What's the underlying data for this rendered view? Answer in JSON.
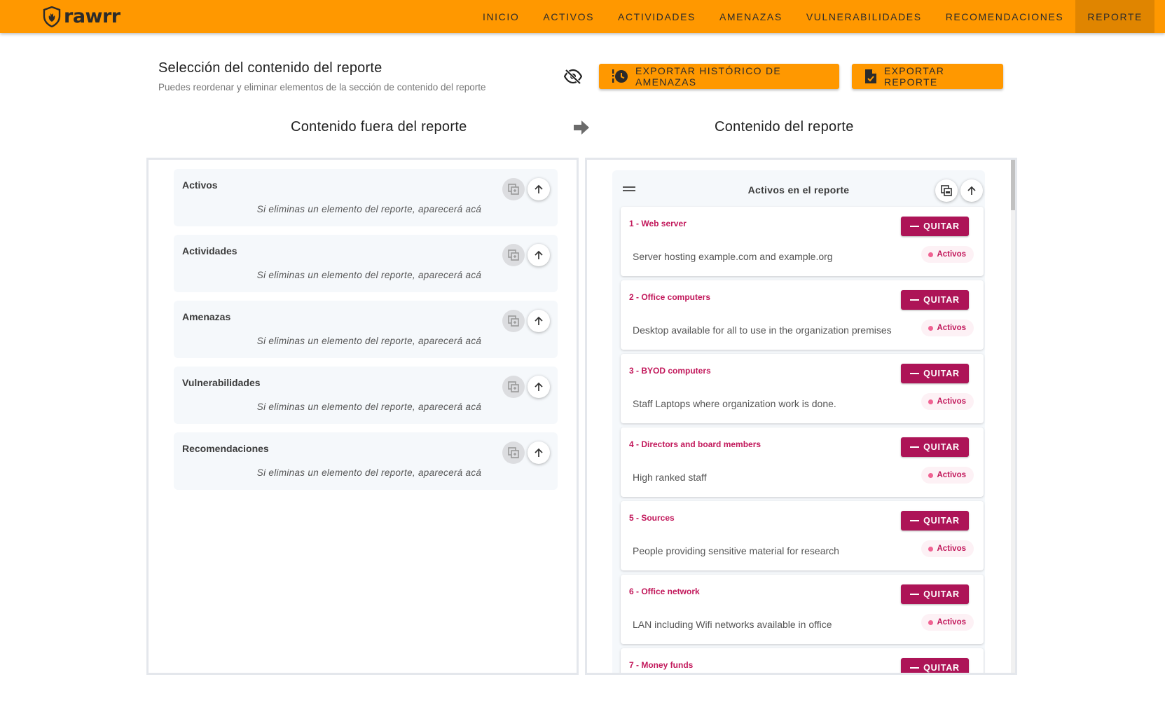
{
  "navbar": {
    "logo_text": "rawrr",
    "items": [
      "INICIO",
      "ACTIVOS",
      "ACTIVIDADES",
      "AMENAZAS",
      "VULNERABILIDADES",
      "RECOMENDACIONES",
      "REPORTE"
    ],
    "active": "REPORTE"
  },
  "header": {
    "title": "Selección del contenido del reporte",
    "subtitle": "Puedes reordenar y eliminar elementos de la sección de contenido del reporte",
    "export_history_label": "EXPORTAR HISTÓRICO DE AMENAZAS",
    "export_report_label": "EXPORTAR REPORTE"
  },
  "left_column": {
    "title": "Contenido fuera del reporte",
    "sections": [
      {
        "title": "Activos",
        "empty_text": "Si eliminas un elemento del reporte, aparecerá acá"
      },
      {
        "title": "Actividades",
        "empty_text": "Si eliminas un elemento del reporte, aparecerá acá"
      },
      {
        "title": "Amenazas",
        "empty_text": "Si eliminas un elemento del reporte, aparecerá acá"
      },
      {
        "title": "Vulnerabilidades",
        "empty_text": "Si eliminas un elemento del reporte, aparecerá acá"
      },
      {
        "title": "Recomendaciones",
        "empty_text": "Si eliminas un elemento del reporte, aparecerá acá"
      }
    ]
  },
  "right_column": {
    "title": "Contenido del reporte",
    "section_title": "Activos en el reporte",
    "remove_label": "QUITAR",
    "items": [
      {
        "title": "1 - Web server",
        "description": "Server hosting example.com and example.org",
        "badge": "Activos"
      },
      {
        "title": "2 - Office computers",
        "description": "Desktop available for all to use in the organization premises",
        "badge": "Activos"
      },
      {
        "title": "3 - BYOD computers",
        "description": "Staff Laptops where organization work is done.",
        "badge": "Activos"
      },
      {
        "title": "4 - Directors and board members",
        "description": "High ranked staff",
        "badge": "Activos"
      },
      {
        "title": "5 - Sources",
        "description": "People providing sensitive material for research",
        "badge": "Activos"
      },
      {
        "title": "6 - Office network",
        "description": "LAN including Wifi networks available in office",
        "badge": "Activos"
      },
      {
        "title": "7 - Money funds",
        "description": "",
        "badge": ""
      }
    ]
  },
  "colors": {
    "primary": "#ff9800",
    "primary_dark": "#e08500",
    "accent": "#ad1457",
    "accent_text": "#c2185b"
  },
  "icons": {
    "logo": "shield-flame-icon",
    "hide": "eye-off-icon",
    "history": "history-icon",
    "report_file": "file-icon",
    "arrow": "arrow-right-icon",
    "copy": "copy-icon",
    "move_up": "arrow-up-icon",
    "drag": "drag-handle-icon"
  }
}
